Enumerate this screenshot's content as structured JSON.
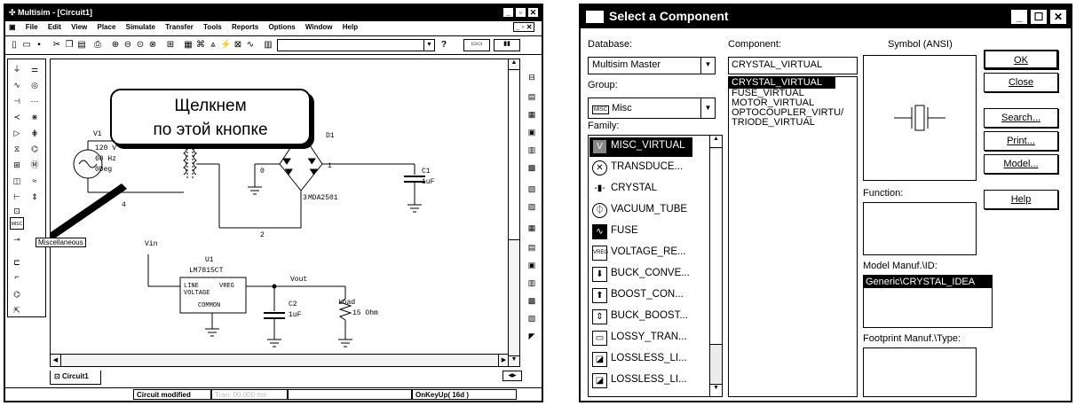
{
  "left_window": {
    "title": "Multisim - [Circuit1]",
    "menu": [
      "File",
      "Edit",
      "View",
      "Place",
      "Simulate",
      "Transfer",
      "Tools",
      "Reports",
      "Options",
      "Window",
      "Help"
    ],
    "toolbar_help": "?",
    "tooltip": "Miscellaneous",
    "callout_line1": "Щелкнем",
    "callout_line2": "по этой кнопке",
    "tab": "Circuit1",
    "status": [
      "Circuit modified",
      "Tran: 00.000 ms",
      "OnKeyUp( 16d )"
    ],
    "circuit": {
      "v1_label": "V1",
      "v1_volts": "120 V",
      "v1_freq": "60 Hz",
      "v1_phase": "0Deg",
      "d1": "D1",
      "d1_model": "MDA2501",
      "c1": "C1",
      "c1_val": "1uF",
      "vin": "Vin",
      "u1": "U1",
      "u1_model": "LM7815CT",
      "u1_line": "LINE",
      "u1_vreg": "VREG",
      "u1_voltage": "VOLTAGE",
      "u1_common": "COMMON",
      "vout": "Vout",
      "c2": "C2",
      "c2_val": "1uF",
      "load": "Load",
      "load_val": "15 Ohm",
      "node0": "0",
      "node1": "1",
      "node2": "2",
      "node3": "3",
      "node4": "4"
    }
  },
  "dialog": {
    "title": "Select a Component",
    "database_label": "Database:",
    "database_value": "Multisim Master",
    "group_label": "Group:",
    "group_icon": "MISC",
    "group_value": "Misc",
    "family_label": "Family:",
    "families": [
      "MISC_VIRTUAL",
      "TRANSDUCE...",
      "CRYSTAL",
      "VACUUM_TUBE",
      "FUSE",
      "VOLTAGE_RE...",
      "BUCK_CONVE...",
      "BOOST_CON...",
      "BUCK_BOOST...",
      "LOSSY_TRAN...",
      "LOSSLESS_LI...",
      "LOSSLESS_LI..."
    ],
    "component_label": "Component:",
    "component_value": "CRYSTAL_VIRTUAL",
    "components": [
      "CRYSTAL_VIRTUAL",
      "FUSE_VIRTUAL",
      "MOTOR_VIRTUAL",
      "OPTOCOUPLER_VIRTU/",
      "TRIODE_VIRTUAL"
    ],
    "symbol_label": "Symbol (ANSI)",
    "function_label": "Function:",
    "manuf_label": "Model Manuf.\\ID:",
    "manuf_value": "Generic\\CRYSTAL_IDEA",
    "footprint_label": "Footprint Manuf.\\Type:",
    "buttons": [
      "OK",
      "Close",
      "Search...",
      "Print...",
      "Model...",
      "Help"
    ]
  }
}
